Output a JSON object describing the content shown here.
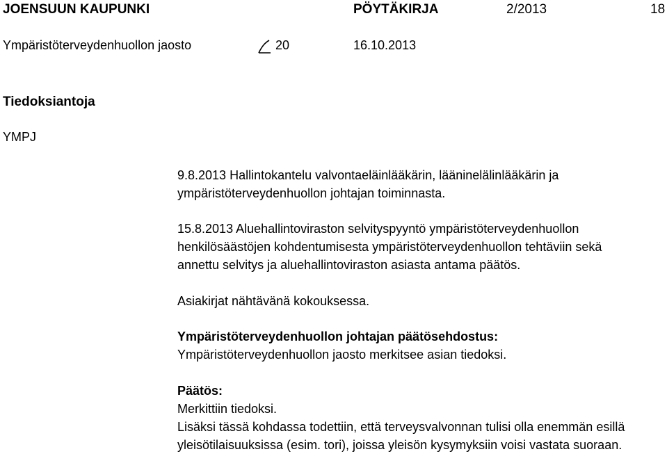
{
  "header": {
    "org": "JOENSUUN KAUPUNKI",
    "doc_type": "PÖYTÄKIRJA",
    "doc_number": "2/2013",
    "page": "18",
    "committee": "Ympäristöterveydenhuollon jaosto",
    "section_number": "20",
    "date": "16.10.2013"
  },
  "section": {
    "title": "Tiedoksiantoja",
    "code": "YMPJ"
  },
  "items": [
    {
      "lines": [
        "9.8.2013 Hallintokantelu valvontaeläinlääkärin, lääninelälinlääkärin ja",
        "ympäristöterveydenhuollon johtajan toiminnasta."
      ]
    },
    {
      "lines": [
        "15.8.2013 Aluehallintoviraston selvityspyyntö ympäristöterveydenhuollon",
        "henkilösäästöjen kohdentumisesta ympäristöterveydenhuollon tehtäviin sekä",
        "annettu selvitys ja aluehallintoviraston asiasta antama päätös."
      ]
    }
  ],
  "note": "Asiakirjat nähtävänä kokouksessa.",
  "proposal": {
    "heading": "Ympäristöterveydenhuollon johtajan päätösehdostus:",
    "text": "Ympäristöterveydenhuollon jaosto merkitsee asian tiedoksi."
  },
  "decision": {
    "heading": "Päätös:",
    "lines": [
      "Merkittiin tiedoksi.",
      "Lisäksi tässä kohdassa todettiin, että terveysvalvonnan tulisi olla enemmän esillä",
      "yleisötilaisuuksissa (esim. tori), joissa yleisön kysymyksiin voisi vastata suoraan."
    ]
  }
}
